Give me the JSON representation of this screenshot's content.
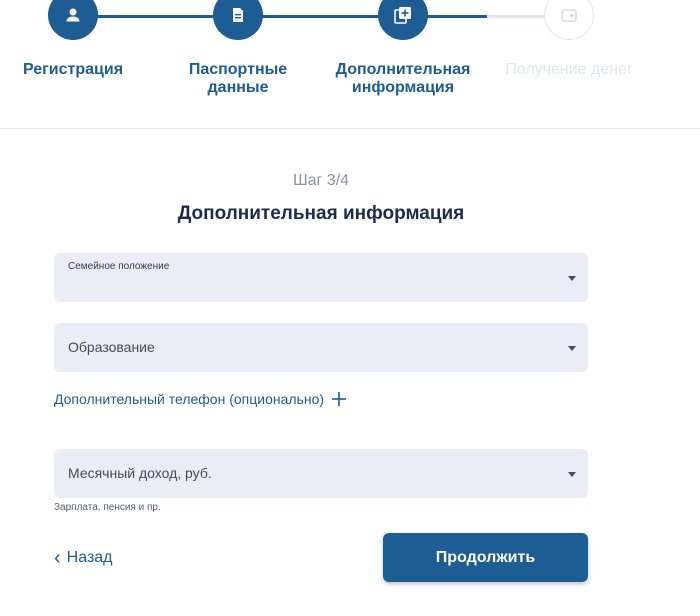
{
  "stepper": {
    "steps": [
      {
        "label": "Регистрация",
        "icon": "user-icon",
        "state": "done"
      },
      {
        "label": "Паспортные\nданные",
        "icon": "document-icon",
        "state": "done"
      },
      {
        "label": "Дополнительная\nинформация",
        "icon": "add-document-icon",
        "state": "active"
      },
      {
        "label": "Получение денег",
        "icon": "wallet-icon",
        "state": "inactive"
      }
    ]
  },
  "form": {
    "step_counter": "Шаг 3/4",
    "title": "Дополнительная информация",
    "marital_status": {
      "label": "Семейное положение",
      "value": ""
    },
    "education": {
      "placeholder": "Образование"
    },
    "extra_phone": {
      "label": "Дополнительный телефон (опционально)",
      "icon": "plus-icon"
    },
    "income": {
      "placeholder": "Месячный доход, руб.",
      "hint": "Зарплата, пенсия и пр."
    }
  },
  "actions": {
    "back_label": "Назад",
    "continue_label": "Продолжить"
  },
  "colors": {
    "accent": "#1d5d93",
    "field_bg": "#ebedf6",
    "inactive": "#e3e6ec"
  }
}
